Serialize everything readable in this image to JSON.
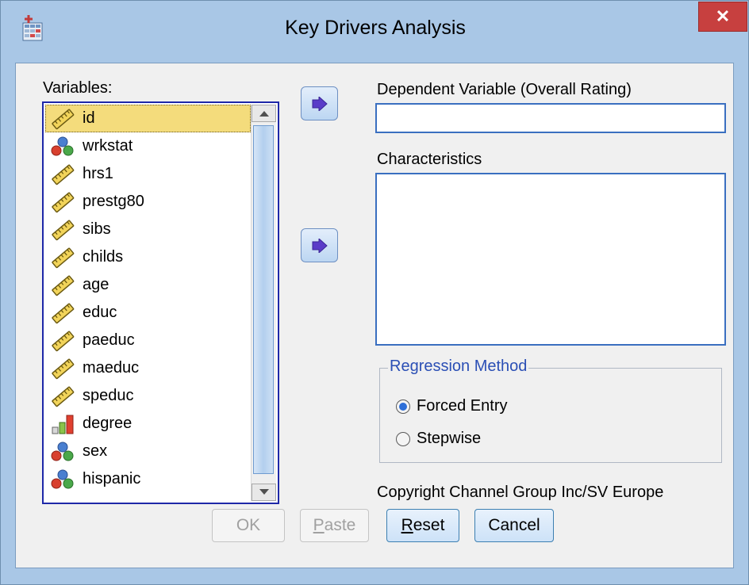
{
  "window": {
    "title": "Key Drivers Analysis",
    "close_glyph": "✕"
  },
  "variables_label": "Variables:",
  "variables": [
    {
      "name": "id",
      "icon": "scale-icon"
    },
    {
      "name": "wrkstat",
      "icon": "nominal-icon"
    },
    {
      "name": "hrs1",
      "icon": "scale-icon"
    },
    {
      "name": "prestg80",
      "icon": "scale-icon"
    },
    {
      "name": "sibs",
      "icon": "scale-icon"
    },
    {
      "name": "childs",
      "icon": "scale-icon"
    },
    {
      "name": "age",
      "icon": "scale-icon"
    },
    {
      "name": "educ",
      "icon": "scale-icon"
    },
    {
      "name": "paeduc",
      "icon": "scale-icon"
    },
    {
      "name": "maeduc",
      "icon": "scale-icon"
    },
    {
      "name": "speduc",
      "icon": "scale-icon"
    },
    {
      "name": "degree",
      "icon": "ordinal-icon"
    },
    {
      "name": "sex",
      "icon": "nominal-icon"
    },
    {
      "name": "hispanic",
      "icon": "nominal-icon"
    }
  ],
  "selected_variable": "id",
  "dependent_label": "Dependent Variable (Overall Rating)",
  "dependent_value": "",
  "characteristics_label": "Characteristics",
  "regression": {
    "legend": "Regression Method",
    "options": [
      {
        "label": "Forced Entry",
        "checked": true
      },
      {
        "label": "Stepwise",
        "checked": false
      }
    ]
  },
  "copyright": "Copyright Channel Group Inc/SV Europe",
  "buttons": {
    "ok": {
      "label": "OK",
      "enabled": false
    },
    "paste": {
      "label": "Paste",
      "mnemonic": "P",
      "rest": "aste",
      "enabled": false
    },
    "reset": {
      "label": "Reset",
      "mnemonic": "R",
      "rest": "eset",
      "enabled": true
    },
    "cancel": {
      "label": "Cancel",
      "enabled": true
    }
  },
  "colors": {
    "accent_blue": "#1e28a8",
    "selection": "#f4dc7c",
    "close_red": "#c7403f",
    "legend_blue": "#2b4fb5"
  }
}
